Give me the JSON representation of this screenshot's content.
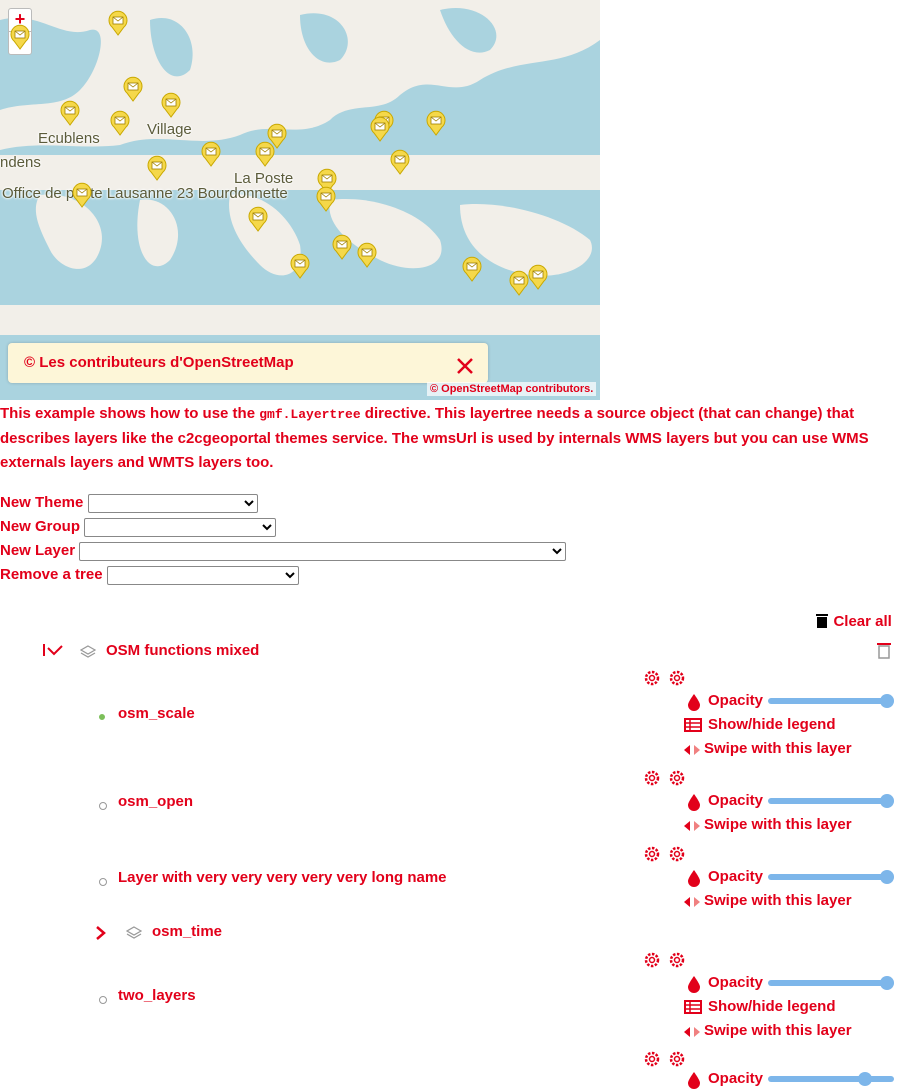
{
  "map": {
    "zoom_in": "+",
    "zoom_out": "−",
    "places": [
      "Ecublens",
      "Village",
      "ndens",
      "La Poste",
      "Office de poste Lausanne 23 Bourdonnette"
    ],
    "popup_text": "© Les contributeurs d'OpenStreetMap",
    "attribution": "© OpenStreetMap contributors."
  },
  "description": {
    "part1": "This example shows how to use the ",
    "code": "gmf.Layertree",
    "part2": " directive. This layertree needs a source object (that can change) that describes layers like the c2cgeoportal themes service. The wmsUrl is used by internals WMS layers but you can use WMS externals layers and WMTS layers too."
  },
  "form": {
    "new_theme": "New Theme",
    "new_group": "New Group",
    "new_layer": "New Layer",
    "remove_tree": "Remove a tree"
  },
  "tree": {
    "clear_all": "Clear all",
    "group_name": "OSM functions mixed",
    "opacity": "Opacity",
    "legend": "Show/hide legend",
    "swipe": "Swipe with this layer",
    "layers": [
      "osm_scale",
      "osm_open",
      "Layer with very very very very very long name",
      "osm_time",
      "two_layers"
    ]
  },
  "colors": {
    "accent": "#e2001a",
    "slider": "#7db6ea",
    "water": "#aad3df",
    "land": "#f2efe9",
    "marker": "#f5d84a"
  }
}
